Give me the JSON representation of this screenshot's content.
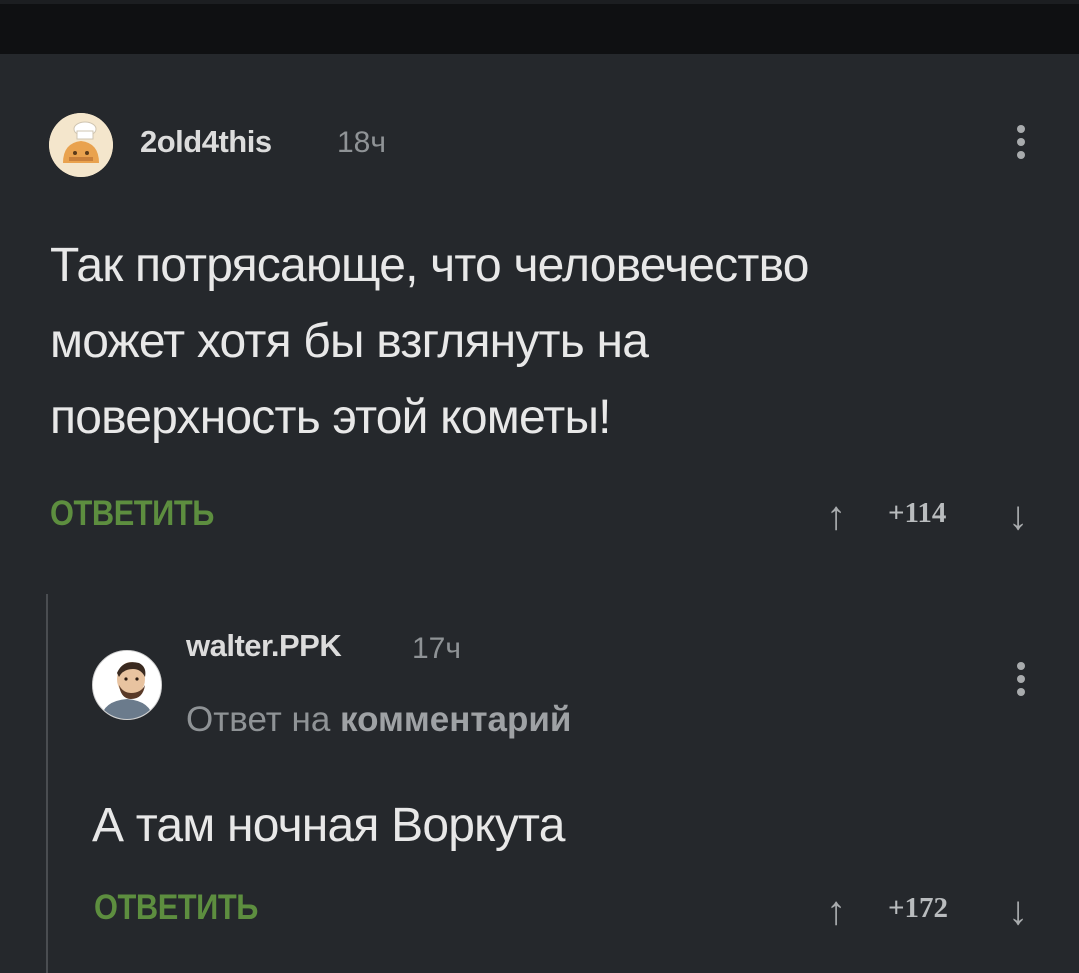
{
  "comments": [
    {
      "username": "2old4this",
      "time": "18ч",
      "text_lines": [
        "Так потрясающе, что человечество",
        "может хотя бы взглянуть на",
        "поверхность этой кометы!"
      ],
      "reply_label": "ОТВЕТИТЬ",
      "score": "+114",
      "avatar_icon": "cat-with-chef-hat-avatar"
    },
    {
      "username": "walter.PPK",
      "time": "17ч",
      "reply_prefix": "Ответ на ",
      "reply_target": "комментарий",
      "text": "А там ночная Воркута",
      "reply_label": "ОТВЕТИТЬ",
      "score": "+172",
      "avatar_icon": "bearded-man-avatar"
    }
  ],
  "icons": {
    "upvote": "↑",
    "downvote": "↓",
    "menu": "kebab-menu-icon"
  },
  "colors": {
    "background": "#25282c",
    "accent_reply": "#5d8e3f",
    "muted": "#8f9396"
  }
}
